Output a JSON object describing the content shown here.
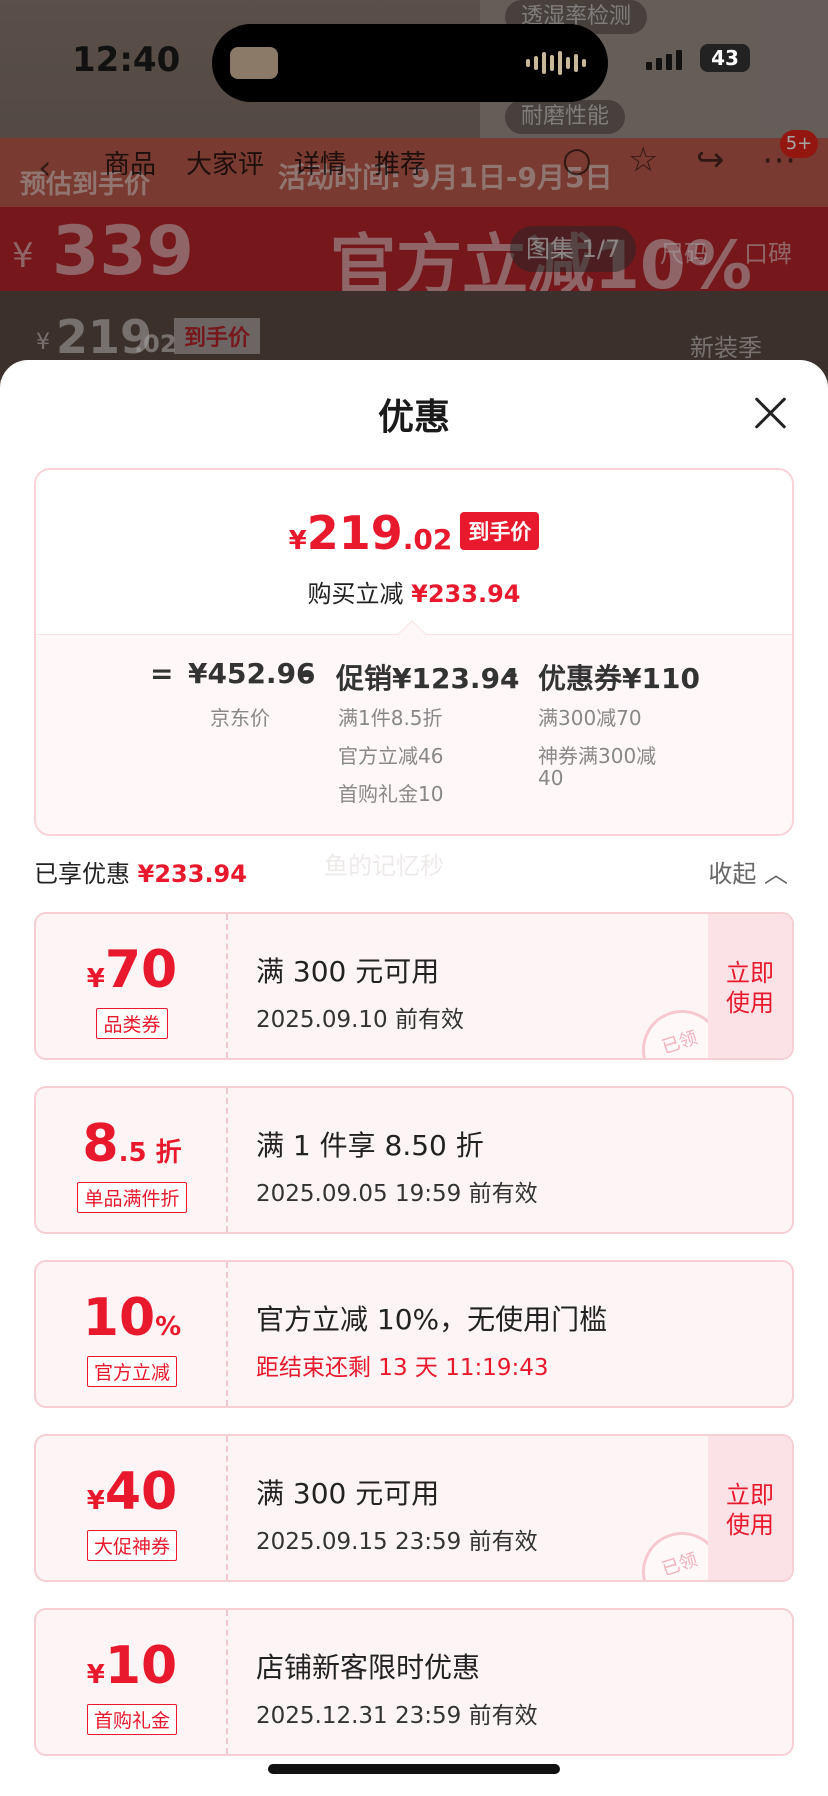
{
  "status": {
    "time": "12:40",
    "battery": "43"
  },
  "background": {
    "chip1": "透湿率检测",
    "chip2": "耐磨性能",
    "banner_title": "预估到手价",
    "banner_period": "活动时间: 9月1日-9月5日",
    "banner_price": "339",
    "banner_slogan": "官方立减10%",
    "gallery": "图集 1/7",
    "size": "尺码",
    "reputation": "口碑",
    "price_int": "219",
    "price_dec": ".02",
    "price_tag": "到手价",
    "new_season": "新装季",
    "currency": "¥"
  },
  "nav": {
    "tabs": [
      "商品",
      "大家评",
      "详情",
      "推荐"
    ],
    "badge": "5+"
  },
  "sheet": {
    "title": "优惠",
    "final_price": {
      "currency": "¥",
      "int": "219",
      "dec": ".02",
      "tag": "到手价"
    },
    "reduce_label": "购买立减",
    "reduce_value": "¥233.94",
    "formula": {
      "eq": "=",
      "jd_price": "¥452.96",
      "jd_label": "京东价",
      "minus1": "–",
      "promo": "促销¥123.94",
      "promo_items": [
        "满1件8.5折",
        "官方立减46",
        "首购礼金10"
      ],
      "minus2": "–",
      "coupon": "优惠券¥110",
      "coupon_items": [
        "满300减70",
        "神券满300减",
        "40"
      ]
    },
    "enjoyed_label": "已享优惠",
    "enjoyed_value": "¥233.94",
    "watermark": "鱼的记忆秒",
    "collapse": "收起"
  },
  "coupons": [
    {
      "prefix": "¥",
      "amount": "70",
      "suffix": "",
      "tag": "品类券",
      "line1": "满 300 元可用",
      "line2": "2025.09.10 前有效",
      "use": "立即使用",
      "stamp": "已领"
    },
    {
      "prefix": "",
      "amount": "8",
      "suffix": ".5 折",
      "tag": "单品满件折",
      "line1": "满 1 件享 8.50 折",
      "line2": "2025.09.05 19:59 前有效"
    },
    {
      "prefix": "",
      "amount": "10",
      "suffix": "%",
      "tag": "官方立减",
      "line1": "官方立减 10%，无使用门槛",
      "line2": "距结束还剩 13 天 11:19:43"
    },
    {
      "prefix": "¥",
      "amount": "40",
      "suffix": "",
      "tag": "大促神券",
      "line1": "满 300 元可用",
      "line2": "2025.09.15 23:59 前有效",
      "use": "立即使用",
      "stamp": "已领"
    },
    {
      "prefix": "¥",
      "amount": "10",
      "suffix": "",
      "tag": "首购礼金",
      "line1": "店铺新客限时优惠",
      "line2": "2025.12.31 23:59 前有效"
    }
  ],
  "colors": {
    "accent": "#e8192c",
    "coupon_bg": "#fdf4f5",
    "coupon_border": "#f6cfd5"
  }
}
